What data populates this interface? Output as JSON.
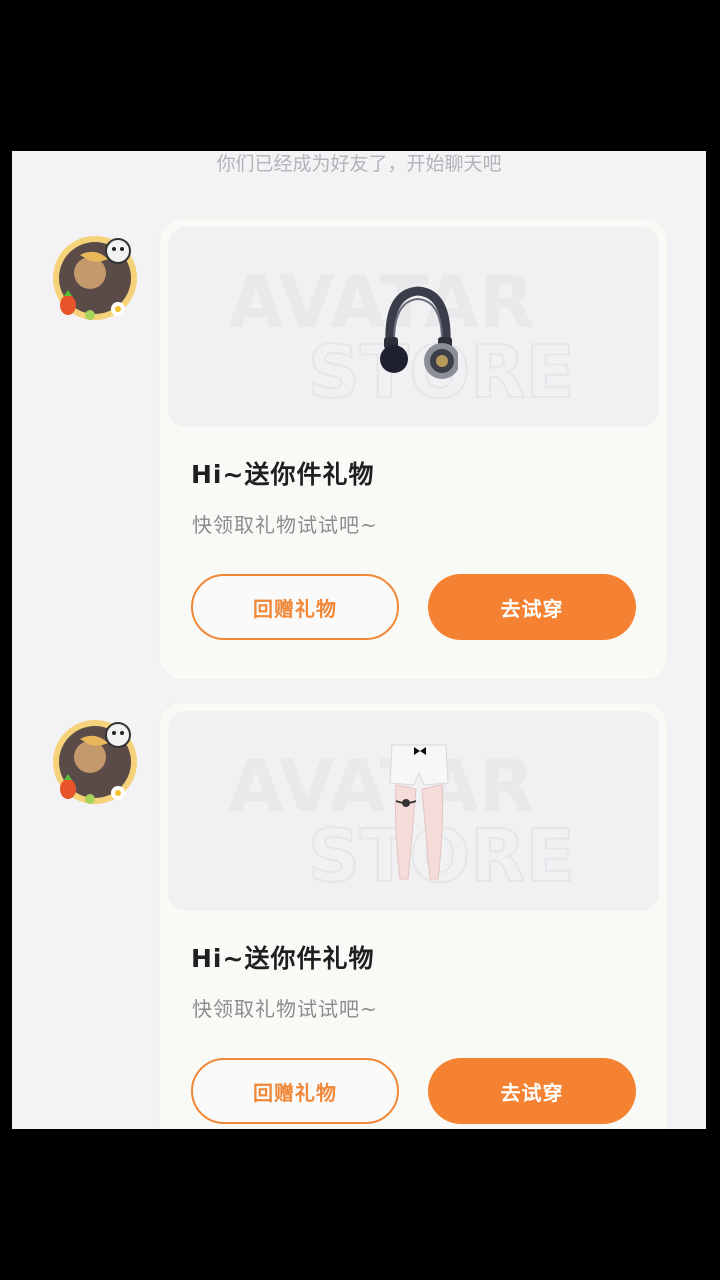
{
  "system_message": "你们已经成为好友了，开始聊天吧",
  "messages": [
    {
      "avatar_icon": "avatar-badge-icon",
      "item_icon": "headphones-icon",
      "watermark": [
        "AVATAR",
        "STORE"
      ],
      "title": "Hi~送你件礼物",
      "subtitle": "快领取礼物试试吧~",
      "return_gift_label": "回赠礼物",
      "try_on_label": "去试穿"
    },
    {
      "avatar_icon": "avatar-badge-icon",
      "item_icon": "shorts-stockings-icon",
      "watermark": [
        "AVATAR",
        "STORE"
      ],
      "title": "Hi~送你件礼物",
      "subtitle": "快领取礼物试试吧~",
      "return_gift_label": "回赠礼物",
      "try_on_label": "去试穿"
    }
  ],
  "colors": {
    "accent": "#f58233",
    "background": "#f3f3f5",
    "card": "#f9f9f6"
  }
}
